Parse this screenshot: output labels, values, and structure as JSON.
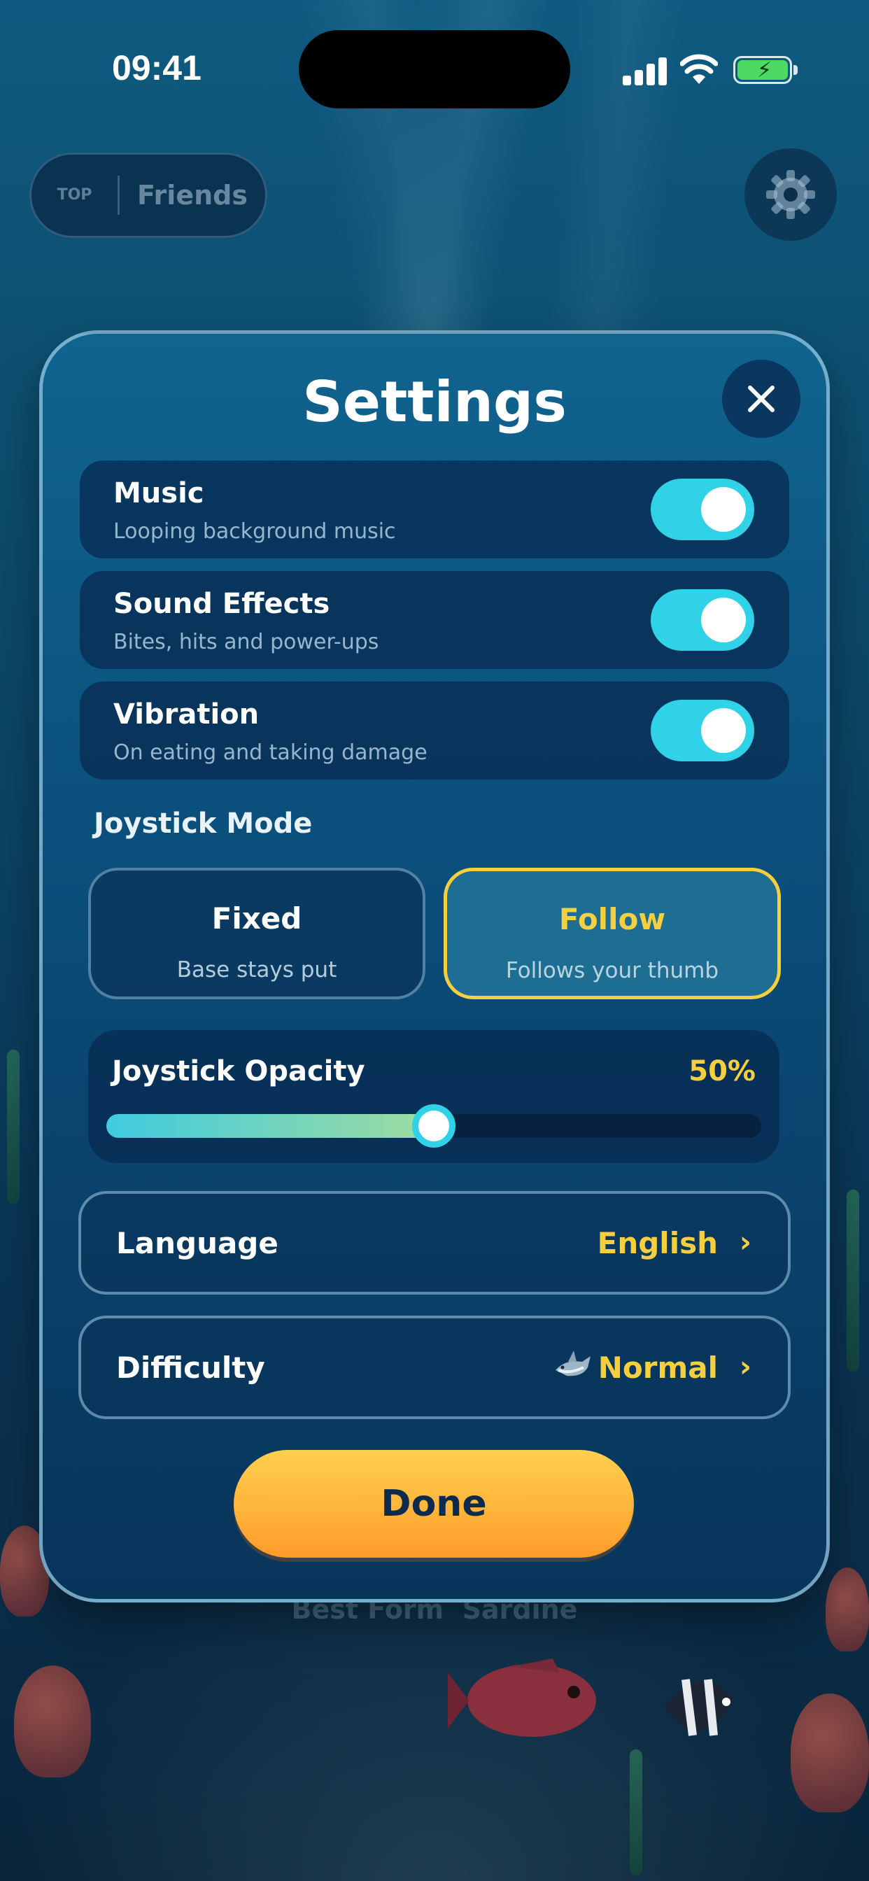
{
  "status_bar": {
    "time": "09:41"
  },
  "top_bar": {
    "top_label": "TOP",
    "friends_label": "Friends"
  },
  "background": {
    "ghost_text": "",
    "best_form_label": "Best Form",
    "best_form_value": "Sardine"
  },
  "settings": {
    "title": "Settings",
    "toggles": [
      {
        "title": "Music",
        "subtitle": "Looping background music",
        "on": true
      },
      {
        "title": "Sound Effects",
        "subtitle": "Bites, hits and power-ups",
        "on": true
      },
      {
        "title": "Vibration",
        "subtitle": "On eating and taking damage",
        "on": true
      }
    ],
    "joystick_mode": {
      "label": "Joystick Mode",
      "options": [
        {
          "title": "Fixed",
          "subtitle": "Base stays put",
          "selected": false
        },
        {
          "title": "Follow",
          "subtitle": "Follows your thumb",
          "selected": true
        }
      ]
    },
    "joystick_opacity": {
      "label": "Joystick Opacity",
      "value_text": "50%",
      "value": 0.5
    },
    "language": {
      "label": "Language",
      "value": "English",
      "chevron": "›"
    },
    "difficulty": {
      "label": "Difficulty",
      "value": "Normal",
      "icon": "shark-icon",
      "chevron": "›"
    },
    "done_label": "Done"
  },
  "colors": {
    "accent_yellow": "#f6cf3e",
    "toggle_on": "#2fd2e6",
    "done_button": "#ffb43a"
  }
}
